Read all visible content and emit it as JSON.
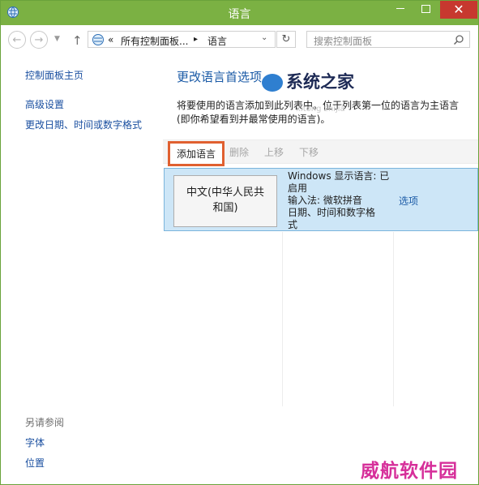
{
  "window": {
    "title": "语言"
  },
  "nav": {
    "back": "←",
    "forward": "→",
    "up": "↑",
    "breadcrumb": [
      "«",
      "所有控制面板...",
      "▸",
      "语言"
    ],
    "refresh": "↻",
    "search_placeholder": "搜索控制面板"
  },
  "sidebar": {
    "links": [
      "控制面板主页",
      "高级设置",
      "更改日期、时间或数字格式"
    ],
    "see_also_label": "另请参阅",
    "see_also": [
      "字体",
      "位置"
    ]
  },
  "main": {
    "heading": "更改语言首选项",
    "description": "将要使用的语言添加到此列表中。位于列表第一位的语言为主语言(即你希望看到并最常使用的语言)。",
    "toolbar": {
      "add": "添加语言",
      "remove": "删除",
      "up": "上移",
      "down": "下移"
    },
    "languages": [
      {
        "name_line1": "中文(中华人民共",
        "name_line2": "和国)",
        "info_line1": "Windows 显示语言: 已",
        "info_line2": "启用",
        "info_line3": "输入法: 微软拼音",
        "info_line4": "日期、时间和数字格",
        "info_line5": "式",
        "options": "选项"
      }
    ]
  },
  "watermarks": {
    "top": "系统之家",
    "top_sub": "xitong zhijia",
    "bottom": "威航软件园"
  },
  "colors": {
    "titlebar": "#7bb143",
    "close": "#c7382f",
    "link": "#1a4fa0",
    "selection": "#cde6f7",
    "highlight_border": "#e06030"
  },
  "icons": [
    "app-icon",
    "back-icon",
    "forward-icon",
    "up-icon",
    "control-panel-icon",
    "chevron-down-icon",
    "refresh-icon",
    "search-icon"
  ]
}
